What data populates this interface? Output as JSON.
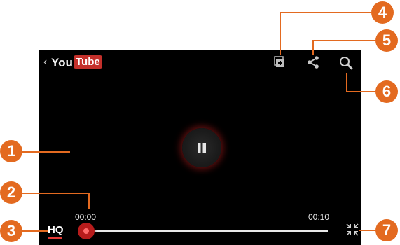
{
  "logo": {
    "back_glyph": "‹",
    "you": "You",
    "tube": "Tube"
  },
  "player": {
    "current_time": "00:00",
    "total_time": "00:10",
    "quality_label": "HQ",
    "progress": 0
  },
  "callouts": {
    "c1": "1",
    "c2": "2",
    "c3": "3",
    "c4": "4",
    "c5": "5",
    "c6": "6",
    "c7": "7"
  },
  "colors": {
    "callout": "#e36a20",
    "accent": "#e53935",
    "logo_red": "#c4302b"
  },
  "icons": [
    "add-to-playlist-icon",
    "share-icon",
    "search-icon",
    "pause-icon",
    "exit-fullscreen-icon"
  ]
}
